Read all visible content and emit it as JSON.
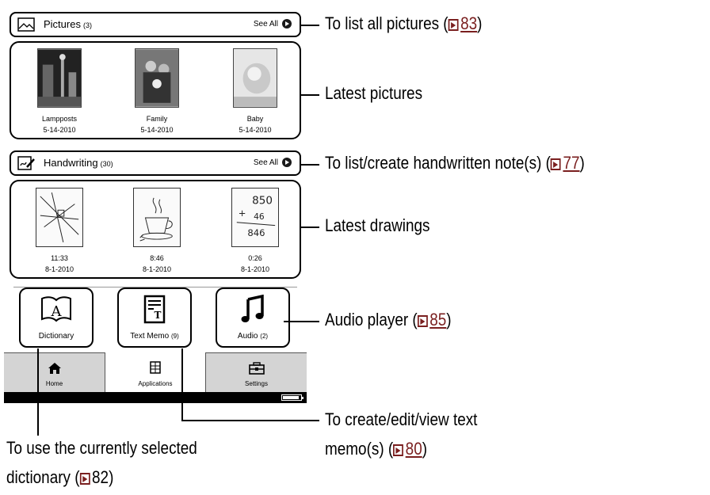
{
  "pictures": {
    "title": "Pictures",
    "count": "(3)",
    "see_all": "See All",
    "items": [
      {
        "name": "Lampposts",
        "date": "5-14-2010"
      },
      {
        "name": "Family",
        "date": "5-14-2010"
      },
      {
        "name": "Baby",
        "date": "5-14-2010"
      }
    ]
  },
  "handwriting": {
    "title": "Handwriting",
    "count": "(30)",
    "see_all": "See All",
    "items": [
      {
        "time": "11:33",
        "date": "8-1-2010"
      },
      {
        "time": "8:46",
        "date": "8-1-2010"
      },
      {
        "time": "0:26",
        "date": "8-1-2010"
      }
    ],
    "drawing_text": "850"
  },
  "apps": {
    "dictionary": {
      "label": "Dictionary",
      "icon": "book-a-icon"
    },
    "text_memo": {
      "label": "Text Memo",
      "count": "(9)",
      "icon": "text-memo-icon"
    },
    "audio": {
      "label": "Audio",
      "count": "(2)",
      "icon": "music-note-icon"
    }
  },
  "tabs": [
    {
      "label": "Home",
      "icon": "home-icon"
    },
    {
      "label": "Applications",
      "icon": "applications-icon"
    },
    {
      "label": "Settings",
      "icon": "toolbox-icon"
    }
  ],
  "battery_level": 1.0,
  "callouts": {
    "list_pictures": {
      "text": "To list all pictures (",
      "page": "83",
      "close": ")"
    },
    "latest_pictures": {
      "text": "Latest pictures"
    },
    "handwritten": {
      "text": "To list/create handwritten note(s) (",
      "page": "77",
      "close": ")"
    },
    "latest_drawings": {
      "text": "Latest drawings"
    },
    "audio_player": {
      "text": "Audio player (",
      "page": "85",
      "close": ")"
    },
    "dictionary_l1": {
      "text": "To use the currently selected"
    },
    "dictionary_l2": {
      "text": "dictionary (",
      "page": "82",
      "close": ")"
    },
    "memo_l1": {
      "text": "To create/edit/view text"
    },
    "memo_l2": {
      "text": "memo(s) (",
      "page": "80",
      "close": ")"
    }
  },
  "colors": {
    "reference": "#7a1f1f",
    "tab_inactive": "#d4d4d4"
  }
}
